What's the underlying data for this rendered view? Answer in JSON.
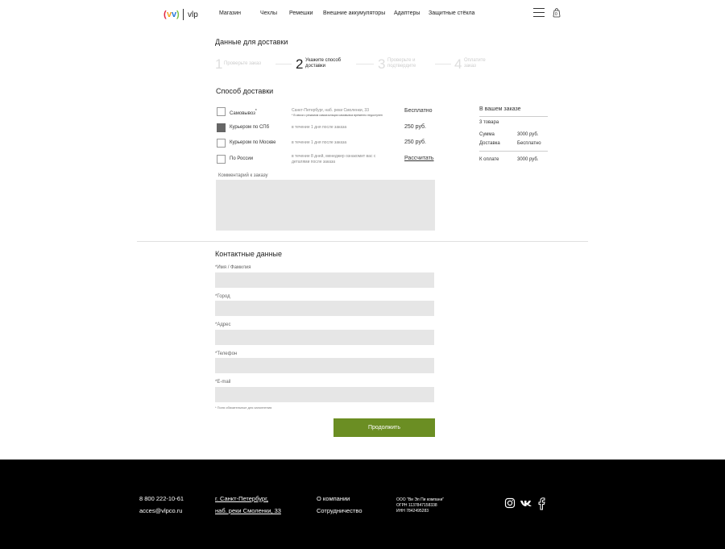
{
  "header": {
    "logo_text": "vlp",
    "nav": [
      "Магазин",
      "Чехлы",
      "Ремешки",
      "Внешние аккумуляторы",
      "Адаптеры",
      "Защитные стёкла"
    ],
    "cart_count": "0"
  },
  "delivery": {
    "title": "Данные для доставки",
    "steps": [
      {
        "num": "1",
        "label": "Проверьте заказ"
      },
      {
        "num": "2",
        "label": "Укажите способ доставки"
      },
      {
        "num": "3",
        "label": "Проверьте и подтвердите"
      },
      {
        "num": "4",
        "label": "Оплатите заказ"
      }
    ],
    "method_title": "Способ доставки",
    "options": [
      {
        "name": "Самовывоз",
        "mark": "*",
        "desc": "Санкт-Петербург, наб. реки Смоленки, 33",
        "note": "* В связи с режимом самоизоляции самовывоз временно недоступен",
        "price": "Бесплатно",
        "checked": false
      },
      {
        "name": "Курьером по СПб",
        "desc": "в течение 1 дня после заказа",
        "price": "250 руб.",
        "checked": true
      },
      {
        "name": "Курьером по Москве",
        "desc": "в течение 1 дня после заказа",
        "price": "250 руб.",
        "checked": false
      },
      {
        "name": "По России",
        "desc": "в течение 8 дней, менеджер ознакомит вас с деталями после заказа",
        "price": "Рассчитать",
        "checked": false
      }
    ],
    "comment_label": "Комментарий к заказу"
  },
  "summary": {
    "title": "В вашем заказе",
    "count": "3 товара",
    "sum_label": "Сумма",
    "sum_value": "3000 руб.",
    "delivery_label": "Доставка",
    "delivery_value": "Бесплатно",
    "pay_label": "К оплате",
    "pay_value": "3000 руб."
  },
  "contacts": {
    "title": "Контактные данные",
    "fields": [
      "Имя / Фамилия",
      "Город",
      "Адрес",
      "Телефон",
      "E-mail"
    ],
    "required_note": "* Поля обязательные для заполнения",
    "submit": "Продолжить"
  },
  "footer": {
    "phone": "8 800 222-10-61",
    "email": "acces@vlpco.ru",
    "address_line1": "г. Санкт-Петербург,",
    "address_line2": "наб. реки Смоленки, 33",
    "about": "О компании",
    "partnership": "Сотрудничество",
    "company": "ООО \"Ви Эл Пи компани\"",
    "ogrn": "ОГРН 1137847158338",
    "inn": "ИНН 7842495283"
  },
  "colors": {
    "accent": "#6b8e23",
    "footer_bg": "#000000",
    "field_bg": "#e6e6e6"
  },
  "icons": [
    "menu-icon",
    "cart-icon",
    "instagram-icon",
    "vk-icon",
    "facebook-icon"
  ]
}
